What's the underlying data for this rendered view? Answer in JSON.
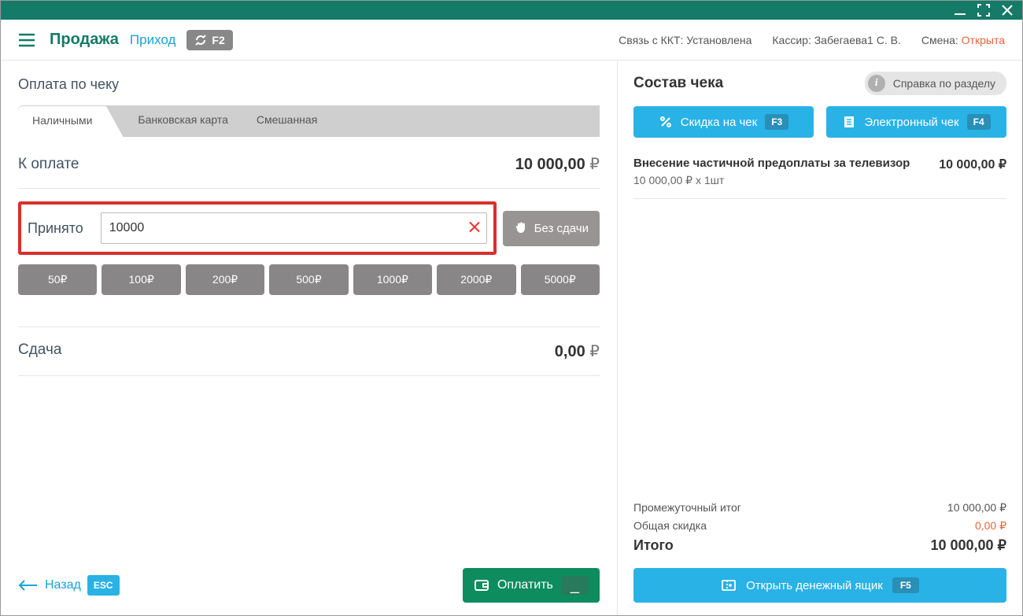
{
  "header": {
    "sale": "Продажа",
    "income": "Приход",
    "refresh_key": "F2",
    "kkt_label": "Связь с ККТ:",
    "kkt_status": "Установлена",
    "cashier_label": "Кассир:",
    "cashier_name": "Забегаева1 С. В.",
    "shift_label": "Смена:",
    "shift_status": "Открыта"
  },
  "left": {
    "title": "Оплата по чеку",
    "tabs": {
      "cash": "Наличными",
      "card": "Банковская карта",
      "mixed": "Смешанная"
    },
    "to_pay_label": "К оплате",
    "to_pay_amount": "10 000,00",
    "currency": "₽",
    "received_label": "Принято",
    "received_value": "10000",
    "no_change": "Без  сдачи",
    "money": [
      "50₽",
      "100₽",
      "200₽",
      "500₽",
      "1000₽",
      "2000₽",
      "5000₽"
    ],
    "change_label": "Сдача",
    "change_amount": "0,00",
    "back": "Назад",
    "back_key": "ESC",
    "pay": "Оплатить",
    "pay_key": "_"
  },
  "right": {
    "title": "Состав чека",
    "help": "Справка по разделу",
    "discount_btn": "Скидка на чек",
    "discount_key": "F3",
    "echeck_btn": "Электронный чек",
    "echeck_key": "F4",
    "item": {
      "name": "Внесение частичной предоплаты за телевизор",
      "sub": "10 000,00 ₽ x 1шт",
      "price": "10 000,00 ₽"
    },
    "subtotal_label": "Промежуточный итог",
    "subtotal_value": "10 000,00 ₽",
    "discount_label": "Общая скидка",
    "discount_value": "0,00 ₽",
    "total_label": "Итого",
    "total_value": "10 000,00 ₽",
    "drawer": "Открыть денежный ящик",
    "drawer_key": "F5"
  }
}
